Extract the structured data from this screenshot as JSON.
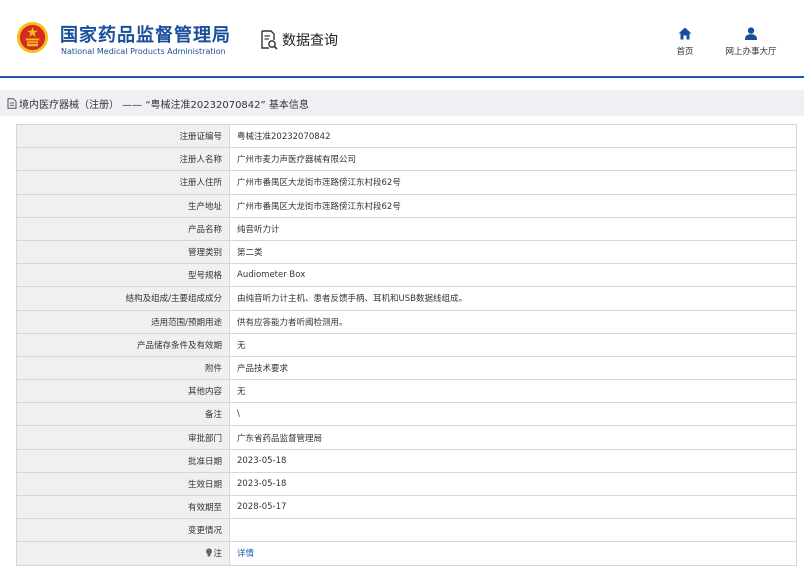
{
  "header": {
    "brand_cn": "国家药品监督管理局",
    "brand_en": "National Medical Products Administration",
    "query_label": "数据查询",
    "nav": {
      "home_label": "首页",
      "office_label": "网上办事大厅"
    }
  },
  "page": {
    "title": "境内医疗器械（注册） —— “粤械注准20232070842” 基本信息"
  },
  "rows": [
    {
      "label": "注册证编号",
      "value": "粤械注准20232070842"
    },
    {
      "label": "注册人名称",
      "value": "广州市麦力声医疗器械有限公司"
    },
    {
      "label": "注册人住所",
      "value": "广州市番禺区大龙街市莲路傍江东村段62号"
    },
    {
      "label": "生产地址",
      "value": "广州市番禺区大龙街市莲路傍江东村段62号"
    },
    {
      "label": "产品名称",
      "value": "纯音听力计"
    },
    {
      "label": "管理类别",
      "value": "第二类"
    },
    {
      "label": "型号规格",
      "value": "Audiometer Box"
    },
    {
      "label": "结构及组成/主要组成成分",
      "value": "由纯音听力计主机、患者反馈手柄、耳机和USB数据线组成。"
    },
    {
      "label": "适用范围/预期用途",
      "value": "供有应答能力者听阈检测用。"
    },
    {
      "label": "产品储存条件及有效期",
      "value": "无"
    },
    {
      "label": "附件",
      "value": "产品技术要求"
    },
    {
      "label": "其他内容",
      "value": "无"
    },
    {
      "label": "备注",
      "value": "\\"
    },
    {
      "label": "审批部门",
      "value": "广东省药品监督管理局"
    },
    {
      "label": "批准日期",
      "value": "2023-05-18"
    },
    {
      "label": "生效日期",
      "value": "2023-05-18"
    },
    {
      "label": "有效期至",
      "value": "2028-05-17"
    },
    {
      "label": "变更情况",
      "value": ""
    },
    {
      "label": "注",
      "value": "详情"
    }
  ],
  "colors": {
    "brand_blue": "#1a4f9e",
    "accent_blue": "#1a58b0",
    "emblem_red": "#d52a1e",
    "emblem_gold": "#f3c11b"
  },
  "icons": {
    "emblem": "national-emblem-icon",
    "query": "document-search-icon",
    "home": "home-icon",
    "office": "user-icon",
    "note": "bulb-icon",
    "title": "document-icon"
  }
}
